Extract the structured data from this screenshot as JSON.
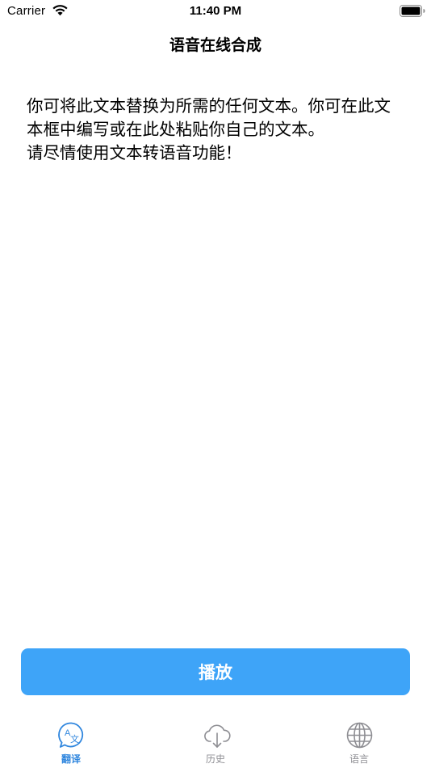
{
  "colors": {
    "accent": "#3ea4f8",
    "tab_active": "#2f86de",
    "tab_inactive": "#8e8e93"
  },
  "status_bar": {
    "carrier": "Carrier",
    "time": "11:40 PM",
    "icons": [
      "wifi-icon",
      "battery-icon"
    ]
  },
  "nav": {
    "title": "语音在线合成"
  },
  "editor": {
    "value": "你可将此文本替换为所需的任何文本。你可在此文本框中编写或在此处粘贴你自己的文本。\n请尽情使用文本转语音功能！"
  },
  "play_button": {
    "label": "播放"
  },
  "tabs": [
    {
      "label": "翻译",
      "icon": "translate-icon",
      "active": true
    },
    {
      "label": "历史",
      "icon": "cloud-download-icon",
      "active": false
    },
    {
      "label": "语言",
      "icon": "globe-icon",
      "active": false
    }
  ]
}
